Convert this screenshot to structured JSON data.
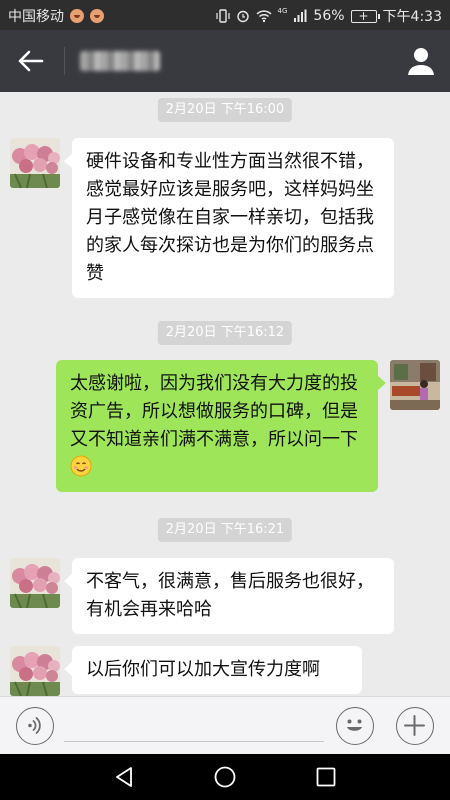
{
  "status_bar": {
    "carrier": "中国移动",
    "network_label": "4G",
    "battery_percent": "56%",
    "time": "下午4:33"
  },
  "header": {
    "icons": [
      "back-arrow-icon",
      "profile-icon"
    ]
  },
  "messages": [
    {
      "type": "time",
      "text": "2月20日  下午16:00"
    },
    {
      "type": "incoming",
      "text": "硬件设备和专业性方面当然很不错，感觉最好应该是服务吧，这样妈妈坐月子感觉像在自家一样亲切，包括我的家人每次探访也是为你们的服务点赞"
    },
    {
      "type": "time",
      "text": "2月20日  下午16:12"
    },
    {
      "type": "outgoing",
      "text": "太感谢啦，因为我们没有大力度的投资广告，所以想做服务的口碑，但是又不知道亲们满不满意，所以问一下",
      "emoji": "smile-emoji"
    },
    {
      "type": "time",
      "text": "2月20日  下午16:21"
    },
    {
      "type": "incoming",
      "text": "不客气，很满意，售后服务也很好，有机会再来哈哈"
    },
    {
      "type": "incoming",
      "text": "以后你们可以加大宣传力度啊"
    }
  ],
  "input_bar": {
    "icons": [
      "voice-icon",
      "emoji-icon",
      "plus-icon"
    ]
  },
  "nav_bar": {
    "icons": [
      "back-triangle-icon",
      "home-circle-icon",
      "recents-square-icon"
    ]
  },
  "colors": {
    "header_bg": "#393a3f",
    "outgoing_bubble": "#9ee55a",
    "incoming_bubble": "#ffffff",
    "chat_bg": "#ebebeb"
  }
}
